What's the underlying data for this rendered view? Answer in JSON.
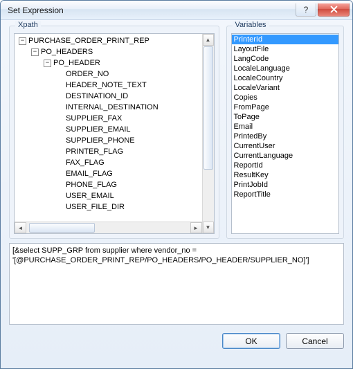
{
  "window": {
    "title": "Set Expression"
  },
  "groups": {
    "xpath": "Xpath",
    "variables": "Variables"
  },
  "tree": {
    "root": {
      "label": "PURCHASE_ORDER_PRINT_REP",
      "expander": "−"
    },
    "l1": {
      "label": "PO_HEADERS",
      "expander": "−"
    },
    "l2": {
      "label": "PO_HEADER",
      "expander": "−"
    },
    "leaves": [
      "ORDER_NO",
      "HEADER_NOTE_TEXT",
      "DESTINATION_ID",
      "INTERNAL_DESTINATION",
      "SUPPLIER_FAX",
      "SUPPLIER_EMAIL",
      "SUPPLIER_PHONE",
      "PRINTER_FLAG",
      "FAX_FLAG",
      "EMAIL_FLAG",
      "PHONE_FLAG",
      "USER_EMAIL",
      "USER_FILE_DIR"
    ]
  },
  "variables": [
    "PrinterId",
    "LayoutFile",
    "LangCode",
    "LocaleLanguage",
    "LocaleCountry",
    "LocaleVariant",
    "Copies",
    "FromPage",
    "ToPage",
    "Email",
    "PrintedBy",
    "CurrentUser",
    "CurrentLanguage",
    "ReportId",
    "ResultKey",
    "PrintJobId",
    "ReportTitle"
  ],
  "selectedVariableIndex": 0,
  "expression": {
    "line1": "[&select SUPP_GRP from supplier where vendor_no =",
    "line2": "'[@PURCHASE_ORDER_PRINT_REP/PO_HEADERS/PO_HEADER/SUPPLIER_NO]']"
  },
  "buttons": {
    "ok": "OK",
    "cancel": "Cancel"
  }
}
